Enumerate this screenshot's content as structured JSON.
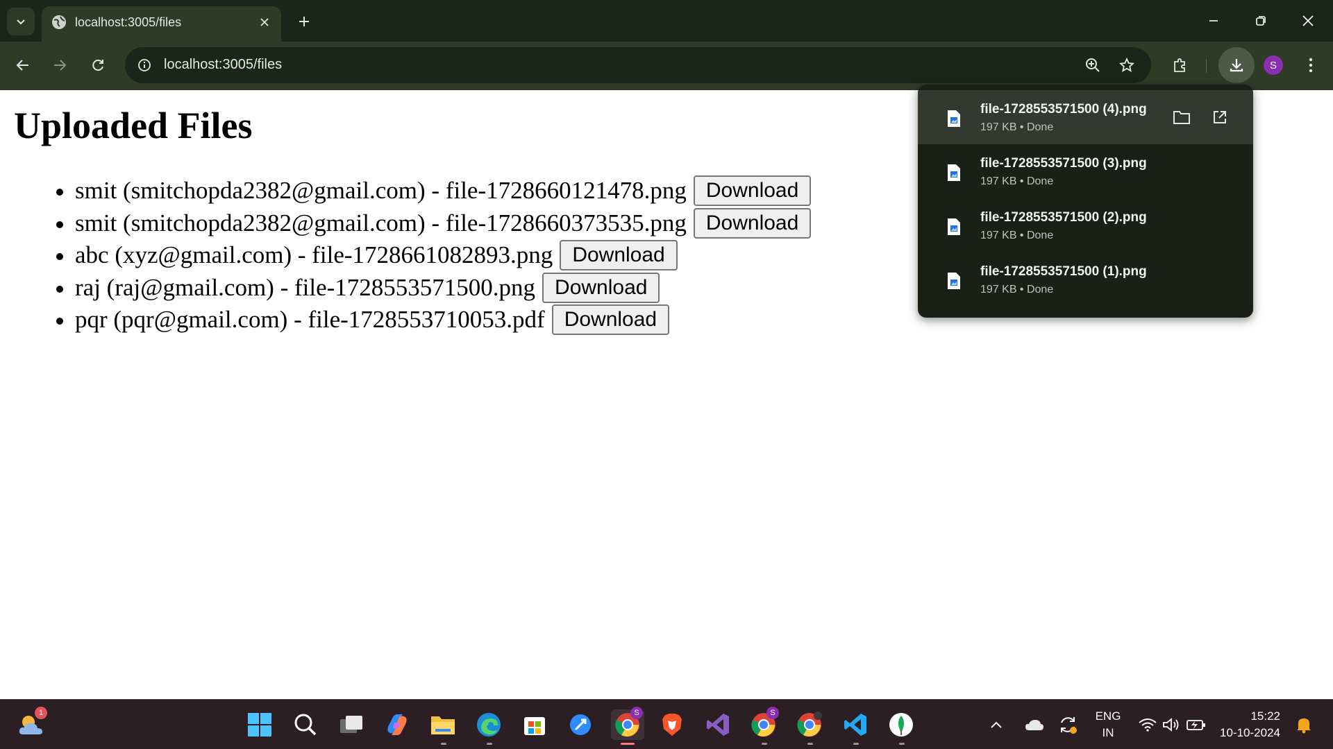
{
  "browser": {
    "tab_title": "localhost:3005/files",
    "url": "localhost:3005/files",
    "profile_initial": "S"
  },
  "page": {
    "heading": "Uploaded Files",
    "files": [
      {
        "text": "smit (smitchopda2382@gmail.com) - file-1728660121478.png",
        "button": "Download"
      },
      {
        "text": "smit (smitchopda2382@gmail.com) - file-1728660373535.png",
        "button": "Download"
      },
      {
        "text": "abc (xyz@gmail.com) - file-1728661082893.png",
        "button": "Download"
      },
      {
        "text": "raj (raj@gmail.com) - file-1728553571500.png",
        "button": "Download"
      },
      {
        "text": "pqr (pqr@gmail.com) - file-1728553710053.pdf",
        "button": "Download"
      }
    ]
  },
  "downloads": [
    {
      "name": "file-1728553571500 (4).png",
      "status": "197 KB • Done"
    },
    {
      "name": "file-1728553571500 (3).png",
      "status": "197 KB • Done"
    },
    {
      "name": "file-1728553571500 (2).png",
      "status": "197 KB • Done"
    },
    {
      "name": "file-1728553571500 (1).png",
      "status": "197 KB • Done"
    }
  ],
  "taskbar": {
    "weather_badge": "1",
    "chrome_profile_badge": "S",
    "language": "ENG",
    "region": "IN",
    "time": "15:22",
    "date": "10-10-2024"
  },
  "colors": {
    "chrome_frame": "#1c2618",
    "chrome_toolbar": "#2e3b27",
    "download_panel": "#1a1f18",
    "taskbar": "#2b1f24"
  }
}
